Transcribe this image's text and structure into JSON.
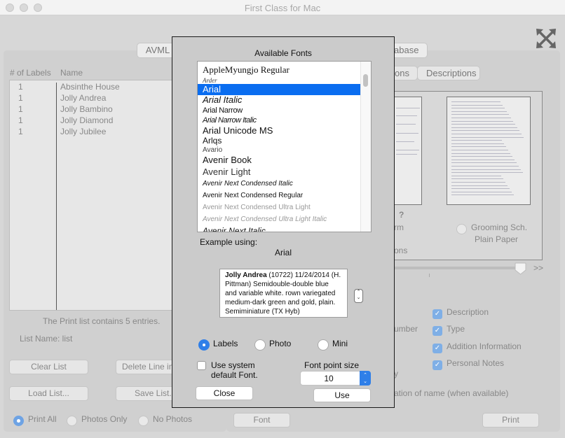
{
  "window": {
    "title": "First Class for Mac"
  },
  "db_tabs": {
    "avml": "AVML",
    "database": "abase"
  },
  "left": {
    "col_count": "# of Labels",
    "col_name": "Name",
    "rows": [
      {
        "count": "1",
        "name": "Absinthe House"
      },
      {
        "count": "1",
        "name": "Jolly Andrea"
      },
      {
        "count": "1",
        "name": "Jolly Bambino"
      },
      {
        "count": "1",
        "name": "Jolly Diamond"
      },
      {
        "count": "1",
        "name": "Jolly Jubilee"
      }
    ],
    "summary": "The Print list contains 5 entries.",
    "list_name": "List Name: list",
    "buttons": {
      "clear": "Clear List",
      "delete": "Delete Line in",
      "load": "Load List...",
      "save": "Save List."
    },
    "print_mode": {
      "options": [
        "Print All",
        "Photos Only",
        "No Photos"
      ],
      "selected": "Print All"
    }
  },
  "right": {
    "sub_tabs": {
      "partial": "ons",
      "descriptions": "Descriptions"
    },
    "preview": {
      "partial_question": "?",
      "partial_label1": "rm",
      "partial_label2": "ons",
      "grooming_line1": "Grooming Sch.",
      "grooming_line2": "Plain Paper",
      "slider_more": ">>"
    },
    "options_partial": {
      "number": "umber",
      "y": "y",
      "name_origin": "ation of name (when available)"
    },
    "checkboxes": [
      {
        "label": "Description",
        "checked": true
      },
      {
        "label": "Type",
        "checked": true
      },
      {
        "label": "Addition Information",
        "checked": true
      },
      {
        "label": "Personal Notes",
        "checked": true
      }
    ],
    "font_button": "Font",
    "print_button": "Print"
  },
  "dialog": {
    "title": "Available Fonts",
    "fonts": [
      "AppleMyungjo Regular",
      "Arder",
      "Arial",
      "Arial Italic",
      "Arial Narrow",
      "Arial Narrow Italic",
      "Arial Unicode MS",
      "Arlqs",
      "Avario",
      "Avenir Book",
      "Avenir Light",
      "Avenir Next Condensed Italic",
      "Avenir Next Condensed Regular",
      "Avenir Next Condensed Ultra Light",
      "Avenir Next Condensed Ultra Light Italic",
      "Avenir Next Italic"
    ],
    "selected_font": "Arial",
    "example_label": "Example using:",
    "example_font": "Arial",
    "example_bold": "Jolly Andrea",
    "example_text": " (10722) 11/24/2014 (H. Pittman) Semidouble-double blue and variable white.  rown variegated medium-dark green and gold, plain. Semiminiature (TX Hyb)",
    "modes": {
      "options": [
        "Labels",
        "Photo",
        "Mini"
      ],
      "selected": "Labels"
    },
    "use_system_line1": "Use system",
    "use_system_line2": "default Font.",
    "use_system_checked": false,
    "font_size_label": "Font point size",
    "font_size_value": "10",
    "close_button": "Close",
    "use_button": "Use"
  }
}
